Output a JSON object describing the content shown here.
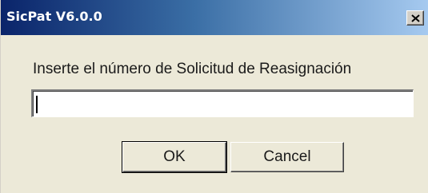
{
  "window": {
    "title": "SicPat V6.0.0"
  },
  "dialog": {
    "prompt": "Inserte el número de Solicitud de Reasignación",
    "input_value": ""
  },
  "buttons": {
    "ok_label": "OK",
    "cancel_label": "Cancel"
  },
  "icons": {
    "close": "close-icon"
  }
}
